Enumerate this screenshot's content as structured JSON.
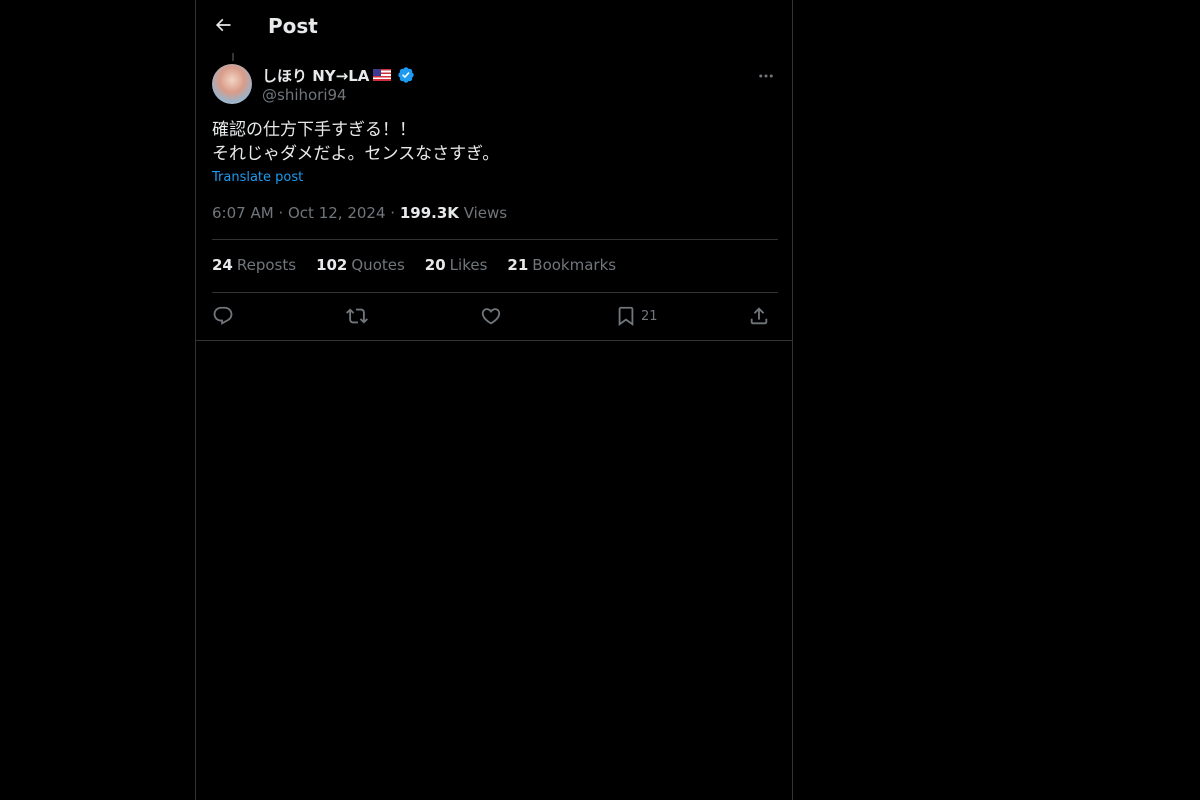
{
  "header": {
    "title": "Post"
  },
  "author": {
    "display_name": "しほり NY→LA",
    "flag": "us-flag",
    "verified": true,
    "handle": "@shihori94"
  },
  "post": {
    "text": "確認の仕方下手すぎる！！\nそれじゃダメだよ。センスなさすぎ。",
    "translate_label": "Translate post",
    "time": "6:07 AM",
    "date": "Oct 12, 2024",
    "views_count": "199.3K",
    "views_label": "Views",
    "separator": "·"
  },
  "stats": [
    {
      "count": "24",
      "label": "Reposts"
    },
    {
      "count": "102",
      "label": "Quotes"
    },
    {
      "count": "20",
      "label": "Likes"
    },
    {
      "count": "21",
      "label": "Bookmarks"
    }
  ],
  "actions": {
    "reply_icon": "reply-icon",
    "repost_icon": "repost-icon",
    "like_icon": "heart-icon",
    "bookmark_icon": "bookmark-icon",
    "bookmark_count": "21",
    "share_icon": "share-icon"
  },
  "colors": {
    "background": "#000000",
    "text": "#e7e9ea",
    "muted": "#71767b",
    "accent": "#1d9bf0",
    "border": "#2f3336"
  }
}
